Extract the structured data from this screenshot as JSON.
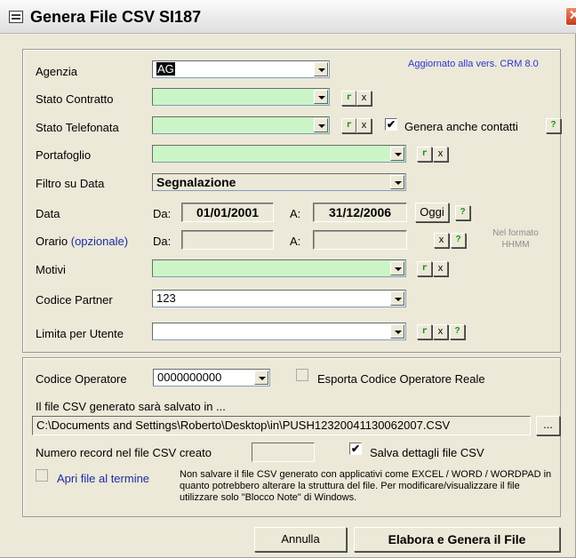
{
  "window": {
    "title": "Genera File CSV SI187",
    "close_glyph": "✕"
  },
  "version_note": "Aggiornato alla vers. CRM 8.0",
  "form": {
    "agenzia": {
      "label": "Agenzia",
      "value": "AG"
    },
    "stato_contratto": {
      "label": "Stato Contratto",
      "value": ""
    },
    "stato_telefonata": {
      "label": "Stato Telefonata",
      "value": ""
    },
    "genera_contatti": {
      "label": "Genera anche contatti",
      "checked": true
    },
    "portafoglio": {
      "label": "Portafoglio",
      "value": ""
    },
    "filtro_data": {
      "label": "Filtro su Data",
      "value": "Segnalazione"
    },
    "data": {
      "label": "Data",
      "da_label": "Da:",
      "da_value": "01/01/2001",
      "a_label": "A:",
      "a_value": "31/12/2006",
      "oggi_label": "Oggi"
    },
    "orario": {
      "label": "Orario",
      "optional": "(opzionale)",
      "da_label": "Da:",
      "a_label": "A:",
      "da_value": "",
      "a_value": ""
    },
    "formato_note": "Nel formato HHMM",
    "motivi": {
      "label": "Motivi",
      "value": ""
    },
    "codice_partner": {
      "label": "Codice Partner",
      "value": "123"
    },
    "limita_utente": {
      "label": "Limita per Utente",
      "value": ""
    }
  },
  "small_buttons": {
    "reset": "r",
    "clear": "x",
    "help": "?"
  },
  "export": {
    "codice_operatore": {
      "label": "Codice Operatore",
      "value": "0000000000"
    },
    "esporta_reale": {
      "label": "Esporta Codice Operatore Reale",
      "checked": false
    },
    "saved_in_label": "Il file CSV generato sarà salvato in ...",
    "path": "C:\\Documents and Settings\\Roberto\\Desktop\\in\\PUSH12320041130062007.CSV",
    "browse_label": "...",
    "record_count_label": "Numero record nel file CSV creato",
    "record_count": "",
    "salva_dettagli": {
      "label": "Salva dettagli file CSV",
      "checked": true
    },
    "apri_file": {
      "label": "Apri file al termine",
      "checked": false
    },
    "warning": "Non salvare il file CSV generato con applicativi come EXCEL / WORD / WORDPAD in quanto potrebbero alterare la struttura del file. Per modificare/visualizzare il file utilizzare solo \"Blocco Note\" di Windows."
  },
  "actions": {
    "annulla": "Annulla",
    "elabora": "Elabora e Genera il File"
  },
  "colors": {
    "required_field": "#ccf5c7",
    "dialog_bg": "#ece9d8",
    "accent_blue": "#1d2ba6"
  }
}
